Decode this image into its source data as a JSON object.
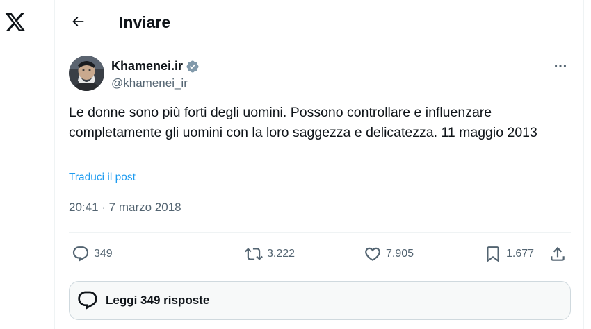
{
  "header": {
    "title": "Inviare"
  },
  "author": {
    "display_name": "Khamenei.ir",
    "handle": "@khamenei_ir",
    "verified": true,
    "verified_color": "#829aab"
  },
  "tweet": {
    "text": "Le donne sono più forti degli uomini. Possono controllare e influenzare completamente gli uomini con la loro saggezza e delicatezza. 11 maggio 2013",
    "translate_label": "Traduci il post",
    "timestamp": "20:41 · 7 marzo 2018"
  },
  "actions": {
    "replies": "349",
    "reposts": "3.222",
    "likes": "7.905",
    "bookmarks": "1.677"
  },
  "read_replies": {
    "label": "Leggi 349 risposte"
  },
  "colors": {
    "text": "#0f1419",
    "secondary": "#536471",
    "link": "#1d9bf0",
    "border": "#eff3f4"
  },
  "icons": [
    "x-logo-icon",
    "back-arrow-icon",
    "verified-badge-icon",
    "more-icon",
    "reply-icon",
    "repost-icon",
    "like-icon",
    "bookmark-icon",
    "share-icon",
    "speech-bubble-icon"
  ]
}
